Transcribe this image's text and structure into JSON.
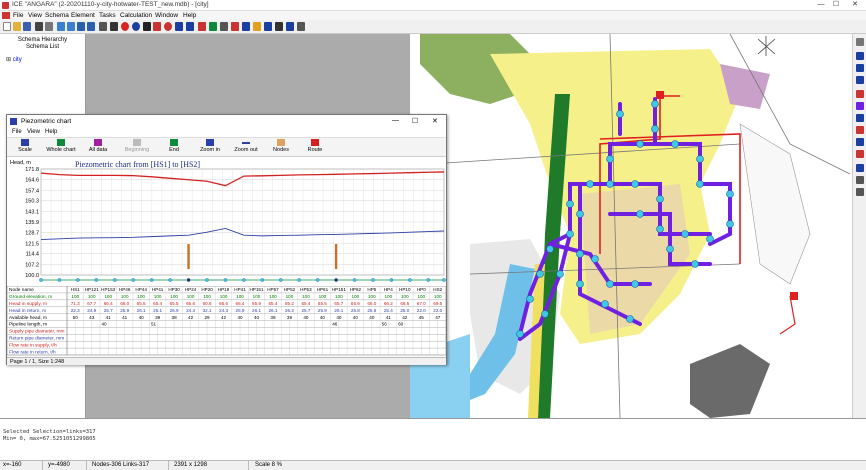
{
  "window": {
    "title": "ICE \"ANGARA\" (2-20201110-y-city-hotwater-TEST_new.mdb) - [city]",
    "controls": [
      "—",
      "☐",
      "✕"
    ]
  },
  "menu": [
    "File",
    "View",
    "Schema",
    "Element",
    "Tasks",
    "Calculation",
    "Window",
    "Help"
  ],
  "schema_panel": {
    "header1": "Schema Hierarchy",
    "header2": "Schema List",
    "root_item": "city"
  },
  "piezometric_window": {
    "title": "Piezometric chart",
    "menu": [
      "File",
      "View",
      "Help"
    ],
    "toolbar": [
      {
        "label": "Scale",
        "icon": "scale-icon",
        "enabled": true
      },
      {
        "label": "Whole chart",
        "icon": "whole-chart-icon",
        "enabled": true
      },
      {
        "label": "All data",
        "icon": "all-data-icon",
        "enabled": true
      },
      {
        "label": "Beginning",
        "icon": "beginning-icon",
        "enabled": false
      },
      {
        "label": "End",
        "icon": "end-icon",
        "enabled": true
      },
      {
        "label": "Zoom in",
        "icon": "zoom-in-icon",
        "enabled": true
      },
      {
        "label": "Zoom out",
        "icon": "zoom-out-icon",
        "enabled": true
      },
      {
        "label": "Nodes",
        "icon": "nodes-icon",
        "enabled": true
      },
      {
        "label": "Route",
        "icon": "route-icon",
        "enabled": true
      }
    ],
    "footer": "Page 1 / 1, Size 1:248"
  },
  "chart_data": {
    "type": "line",
    "title": "Piezometric chart from [HS1] to [HS2]",
    "ylabel": "Head, m",
    "yticks": [
      171.8,
      164.6,
      157.4,
      150.3,
      143.1,
      135.9,
      128.7,
      121.5,
      114.4,
      107.2,
      100.0
    ],
    "ylim": [
      100.0,
      171.8
    ],
    "x": [
      0,
      20,
      40,
      60,
      80,
      100,
      120,
      140,
      160,
      180,
      200,
      220,
      240,
      260,
      280,
      300,
      320,
      340,
      360,
      380,
      400,
      420,
      437
    ],
    "series": [
      {
        "color": "#d42020",
        "values": [
          169,
          168,
          167.5,
          167.5,
          167.5,
          167.3,
          166.5,
          165.5,
          164.5,
          163.5,
          160.5,
          167,
          167.2,
          167.5,
          167.8,
          168,
          168.2,
          168.5,
          168.7,
          169,
          169.3,
          169.6,
          169.8
        ]
      },
      {
        "color": "#2a3fa8",
        "values": [
          124,
          124.5,
          125,
          125.2,
          125.3,
          125.5,
          126,
          126.5,
          127,
          129,
          131.5,
          127,
          126.5,
          126.8,
          127,
          127.3,
          127.5,
          127.8,
          128.2,
          128.5,
          129,
          129.4,
          129.8
        ]
      }
    ],
    "grid": true
  },
  "table": {
    "row_labels": [
      "Node name",
      "Ground elevation, m",
      "Head in supply, m",
      "Head in return, m",
      "Available head, m",
      "Pipeline length, m",
      "Supply pipe diameter, mm",
      "Return pipe diameter, mm",
      "Flow rate in supply, t/h",
      "Flow rate in return, t/h"
    ],
    "row_colors": [
      "#000000",
      "#008000",
      "#d42020",
      "#2a3fa8",
      "#000000",
      "#000000",
      "#d42020",
      "#2a3fa8",
      "#d42020",
      "#2a3fa8"
    ],
    "nodes": [
      "HS1",
      "HP121",
      "HP153",
      "HP46",
      "HP44",
      "HP41",
      "HP30",
      "HP24",
      "HP20",
      "HP18",
      "HP41",
      "HP151",
      "HP57",
      "HP52",
      "HP53",
      "HP61",
      "HP151",
      "HP62",
      "HP5",
      "HP4",
      "HP10",
      "HP0",
      "HS2"
    ],
    "ground": [
      "100",
      "100",
      "100",
      "100",
      "100",
      "100",
      "100",
      "100",
      "100",
      "100",
      "100",
      "100",
      "100",
      "100",
      "100",
      "100",
      "100",
      "100",
      "100",
      "100",
      "100",
      "100",
      "100"
    ],
    "supply": [
      "71.3",
      "67.7",
      "66.4",
      "66.0",
      "65.5",
      "65.4",
      "65.5",
      "66.6",
      "60.8",
      "66.6",
      "66.4",
      "65.9",
      "65.4",
      "65.2",
      "65.4",
      "65.5",
      "65.7",
      "65.9",
      "66.0",
      "66.2",
      "66.5",
      "67.0",
      "69.5"
    ],
    "return_": [
      "22.3",
      "24.9",
      "25.7",
      "25.9",
      "26.1",
      "26.1",
      "26.9",
      "24.3",
      "32.1",
      "24.3",
      "25.9",
      "26.1",
      "26.1",
      "26.2",
      "25.7",
      "25.9",
      "26.1",
      "25.8",
      "25.6",
      "25.4",
      "25.0",
      "22.0",
      "22.0"
    ],
    "available": [
      "50",
      "43",
      "41",
      "41",
      "40",
      "39",
      "38",
      "42",
      "29",
      "42",
      "40",
      "40",
      "39",
      "39",
      "40",
      "40",
      "40",
      "40",
      "40",
      "41",
      "42",
      "45",
      "47"
    ],
    "lengths": {
      "4": "40",
      "10": "51",
      "32": "46",
      "38": "56",
      "40": "60",
      "46": "61"
    }
  },
  "message_panel": {
    "line1": "Selected Selection=links=317",
    "line2": "Min= 0, max=67.5251051299805"
  },
  "status": {
    "x": "x=-160",
    "y": "y=-4980",
    "counts": "Nodes-306 Links-317",
    "size": "2391 x 1298",
    "scale": "Scale 8 %"
  }
}
